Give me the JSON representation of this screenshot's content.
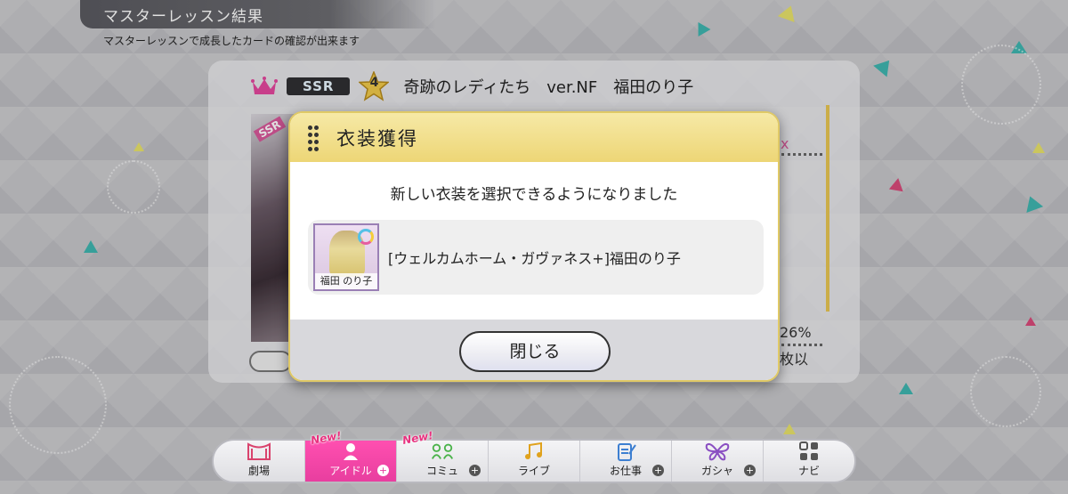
{
  "header": {
    "title": "マスターレッスン結果",
    "subtitle": "マスターレッスンで成長したカードの確認が出来ます"
  },
  "card": {
    "rarity": "SSR",
    "star_level": "4",
    "name": "奇跡のレディたち　ver.NF　福田のり子",
    "stat_right_1": "x",
    "stat_right_2": "26%",
    "stat_right_3": "枚以"
  },
  "modal": {
    "title": "衣装獲得",
    "message": "新しい衣装を選択できるようになりました",
    "item": {
      "name": "[ウェルカムホーム・ガヴァネス+]福田のり子",
      "thumb_label": "福田 のり子"
    },
    "close_label": "閉じる"
  },
  "nav": {
    "items": [
      {
        "label": "劇場",
        "icon": "theater-icon",
        "new": "",
        "plus": ""
      },
      {
        "label": "アイドル",
        "icon": "idol-icon",
        "new": "New!",
        "plus": "+"
      },
      {
        "label": "コミュ",
        "icon": "commu-icon",
        "new": "New!",
        "plus": "+"
      },
      {
        "label": "ライブ",
        "icon": "live-icon",
        "new": "",
        "plus": ""
      },
      {
        "label": "お仕事",
        "icon": "work-icon",
        "new": "",
        "plus": "+"
      },
      {
        "label": "ガシャ",
        "icon": "gacha-icon",
        "new": "",
        "plus": "+"
      },
      {
        "label": "ナビ",
        "icon": "navi-icon",
        "new": "",
        "plus": ""
      }
    ]
  },
  "colors": {
    "accent_pink": "#e83e9f",
    "modal_header_gold": "#edd676",
    "ssr_badge": "#2f2f33"
  }
}
